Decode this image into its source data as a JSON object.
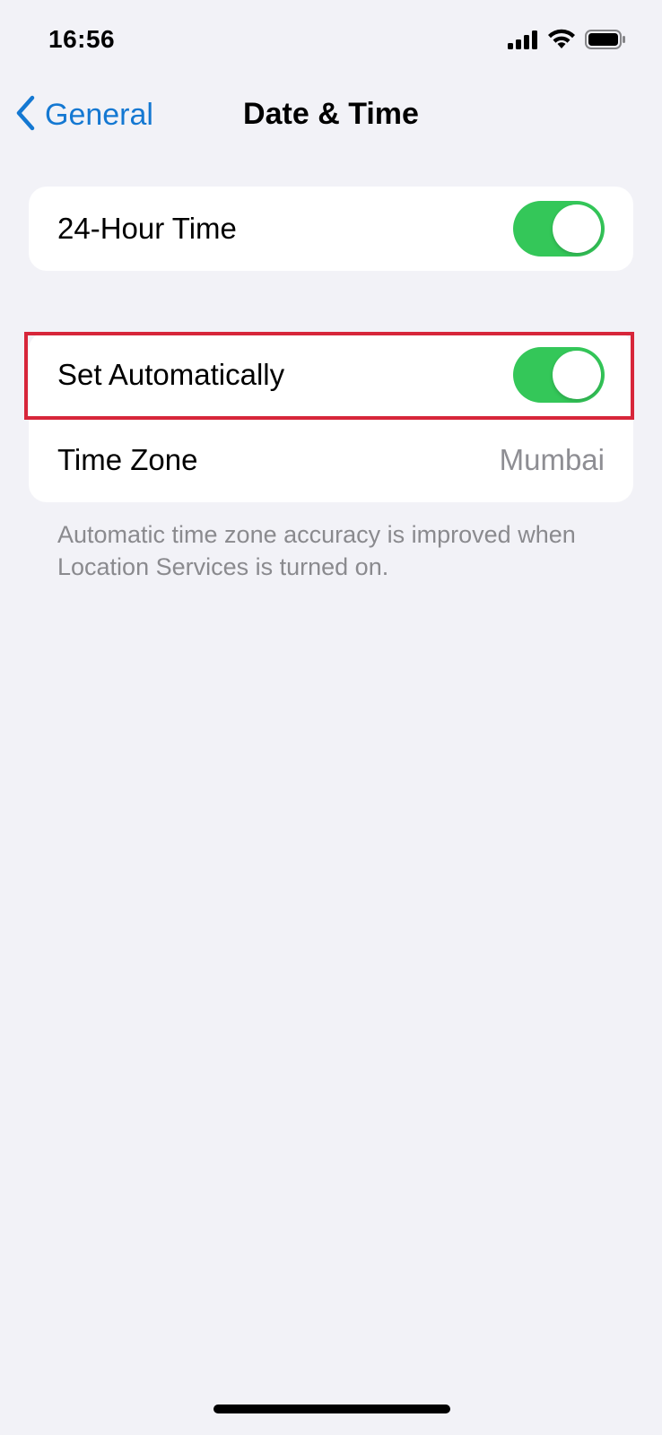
{
  "status_bar": {
    "time": "16:56",
    "icons": [
      "cellular-signal-icon",
      "wifi-icon",
      "battery-icon"
    ]
  },
  "nav": {
    "back_label": "General",
    "title": "Date & Time"
  },
  "settings": {
    "hour24": {
      "label": "24-Hour Time",
      "enabled": true
    },
    "set_automatically": {
      "label": "Set Automatically",
      "enabled": true
    },
    "time_zone": {
      "label": "Time Zone",
      "value": "Mumbai"
    }
  },
  "footnote": "Automatic time zone accuracy is improved when Location Services is turned on.",
  "colors": {
    "accent_blue": "#1478D2",
    "toggle_on": "#34C759",
    "highlight_red": "#D7263A",
    "background": "#F2F2F7"
  }
}
